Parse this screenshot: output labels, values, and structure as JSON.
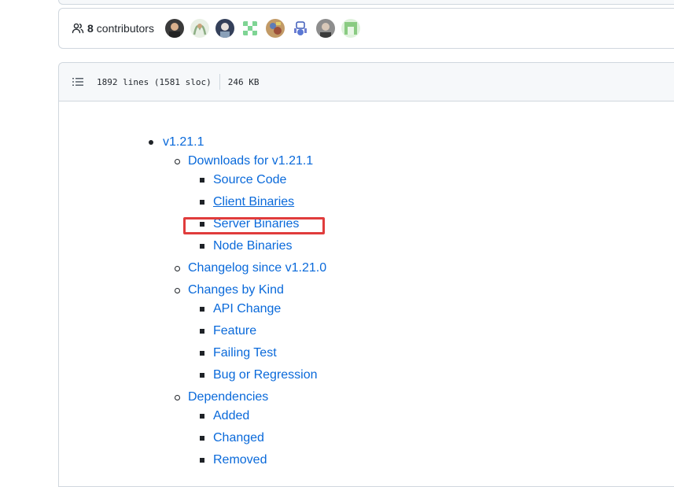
{
  "contributors": {
    "count": "8",
    "label": "contributors",
    "avatar_colors": [
      "#4b4b4b",
      "#c9d6c4",
      "#3c4a5c",
      "#8fd19e",
      "#b58a5a",
      "#6f7fd1",
      "#9a9a9a",
      "#7cc47a"
    ]
  },
  "file_info": {
    "lines": "1892 lines (1581 sloc)",
    "size": "246 KB"
  },
  "toc": {
    "version": "v1.21.1",
    "downloads": "Downloads for v1.21.1",
    "source_code": "Source Code",
    "client_binaries": "Client Binaries",
    "server_binaries": "Server Binaries",
    "node_binaries": "Node Binaries",
    "changelog": "Changelog since v1.21.0",
    "changes_by_kind": "Changes by Kind",
    "api_change": "API Change",
    "feature": "Feature",
    "failing_test": "Failing Test",
    "bug_or_regression": "Bug or Regression",
    "dependencies": "Dependencies",
    "added": "Added",
    "changed": "Changed",
    "removed": "Removed"
  },
  "colors": {
    "link": "#0969da",
    "highlight": "#e03c3c",
    "border": "#d0d7de"
  }
}
